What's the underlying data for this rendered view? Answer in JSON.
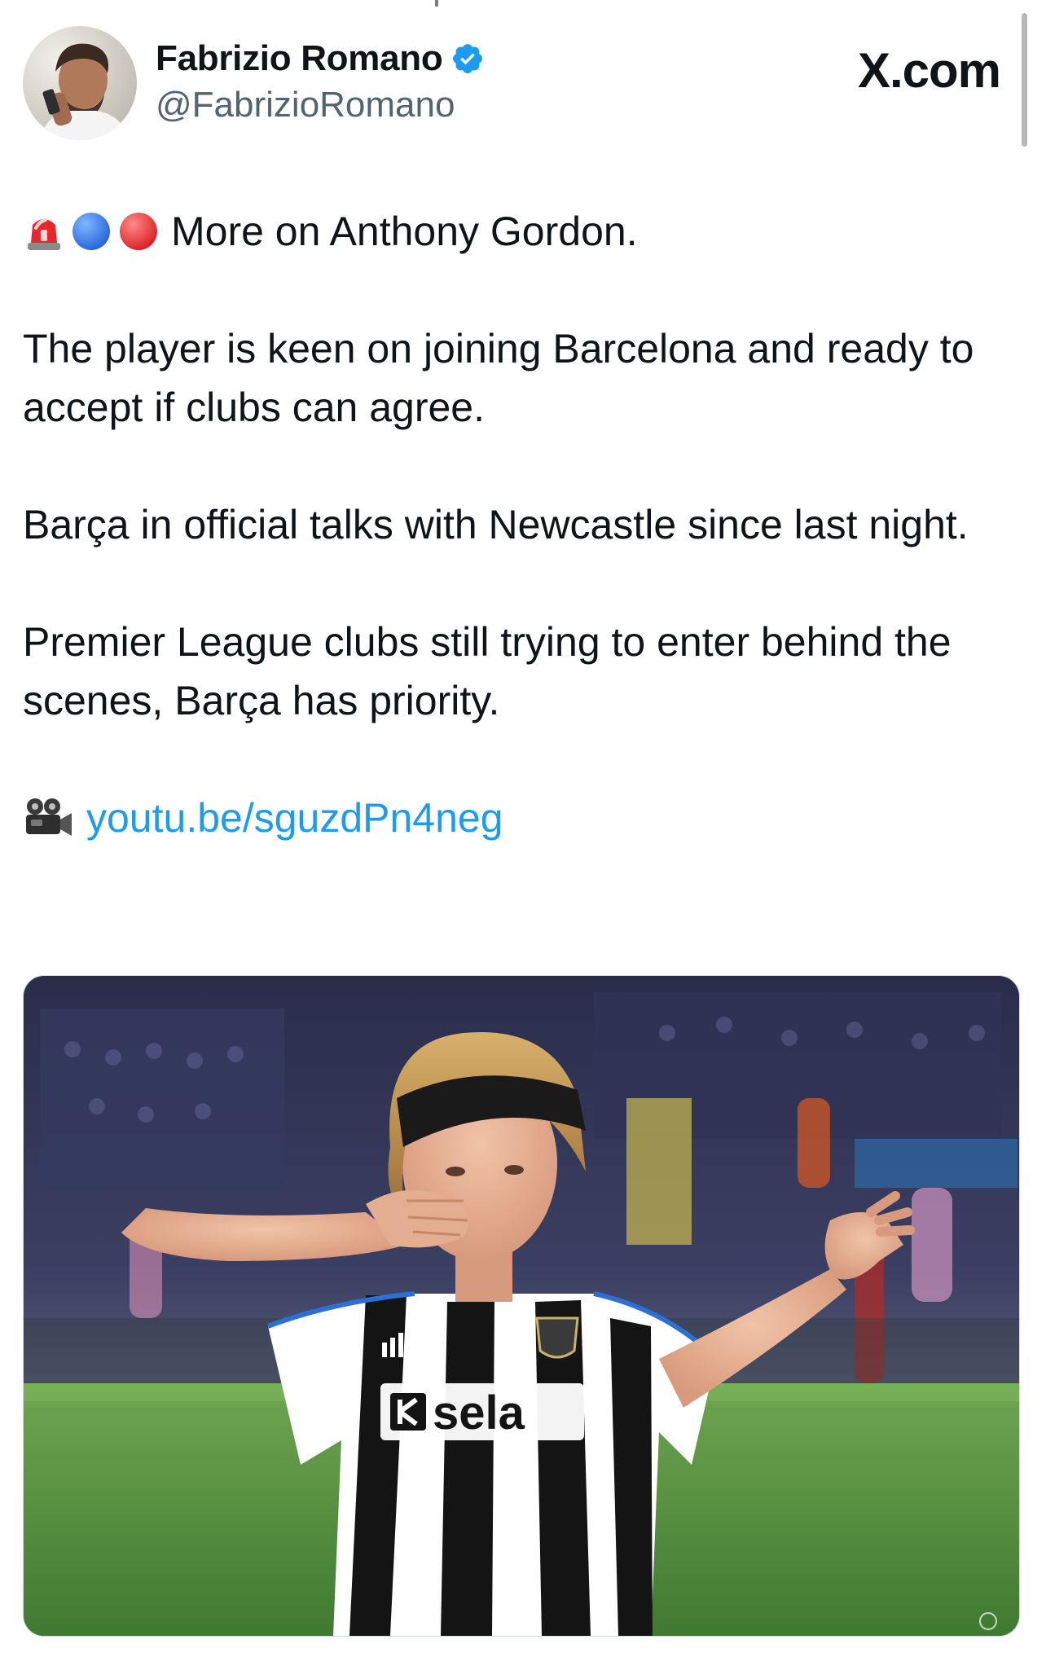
{
  "header": {
    "display_name": "Fabrizio Romano",
    "handle": "@FabrizioRomano",
    "brand": "X.com",
    "avatar_icon": "profile-photo",
    "verified_icon": "verified-badge-icon"
  },
  "tweet": {
    "lines": {
      "intro": "More on Anthony Gordon.",
      "para1": "The player is keen on joining Barcelona and ready to accept if clubs can agree.",
      "para2": "Barça in official talks with Newcastle since last night.",
      "para3": "Premier League clubs still trying to enter behind the scenes, Barça has priority."
    },
    "emojis": [
      "rotating-light-icon",
      "blue-circle-icon",
      "red-circle-icon"
    ],
    "link_icon": "movie-camera-icon",
    "link_text": "youtu.be/sguzdPn4neg",
    "sponsor_text": "sela"
  },
  "colors": {
    "text": "#0f1419",
    "secondary": "#536471",
    "link": "#1d9bf0",
    "verified": "#1d9bf0"
  }
}
